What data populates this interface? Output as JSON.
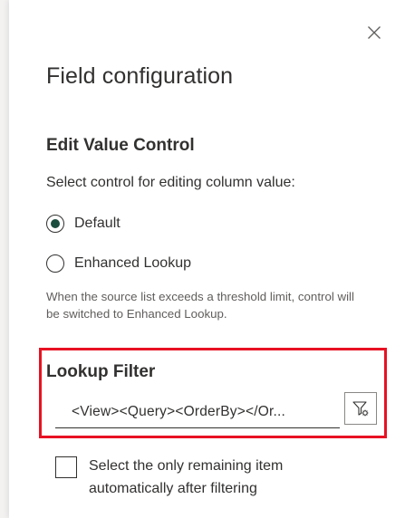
{
  "panel": {
    "title": "Field configuration"
  },
  "edit_value_control": {
    "heading": "Edit Value Control",
    "description": "Select control for editing column value:",
    "options": [
      {
        "label": "Default",
        "checked": true
      },
      {
        "label": "Enhanced Lookup",
        "checked": false
      }
    ],
    "hint": "When the source list exceeds a threshold limit, control will be switched to Enhanced Lookup."
  },
  "lookup_filter": {
    "heading": "Lookup Filter",
    "value": "<View><Query><OrderBy></Or..."
  },
  "auto_select": {
    "label": "Select the only remaining item automatically after filtering",
    "checked": false
  },
  "colors": {
    "highlight": "#e81123",
    "radio_fill": "#1b4d3e",
    "text": "#323130",
    "hint": "#605e5c"
  },
  "icons": {
    "close": "close-icon",
    "filter_settings": "filter-settings-icon"
  }
}
